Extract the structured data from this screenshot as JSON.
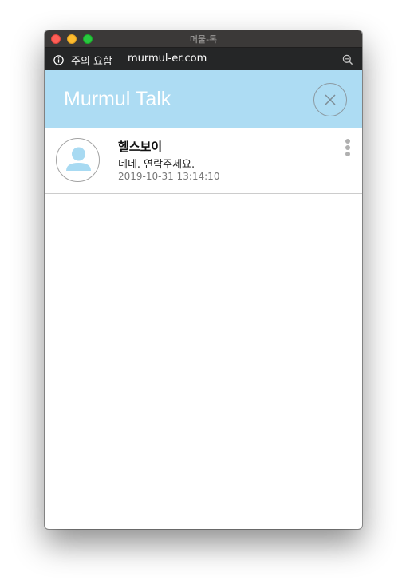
{
  "window": {
    "title": "머물-톡"
  },
  "addressbar": {
    "security_label": "주의 요함",
    "url": "murmul-er.com",
    "info_icon": "info-circle-icon",
    "zoom_icon": "zoom-out-icon"
  },
  "header": {
    "title": "Murmul Talk",
    "close_icon": "close-icon",
    "background": "#addcf3"
  },
  "chats": [
    {
      "name": "헬스보이",
      "last_message": "네네. 연락주세요.",
      "timestamp": "2019-10-31 13:14:10",
      "avatar_icon": "user-avatar-icon",
      "menu_icon": "more-vertical-icon"
    }
  ]
}
